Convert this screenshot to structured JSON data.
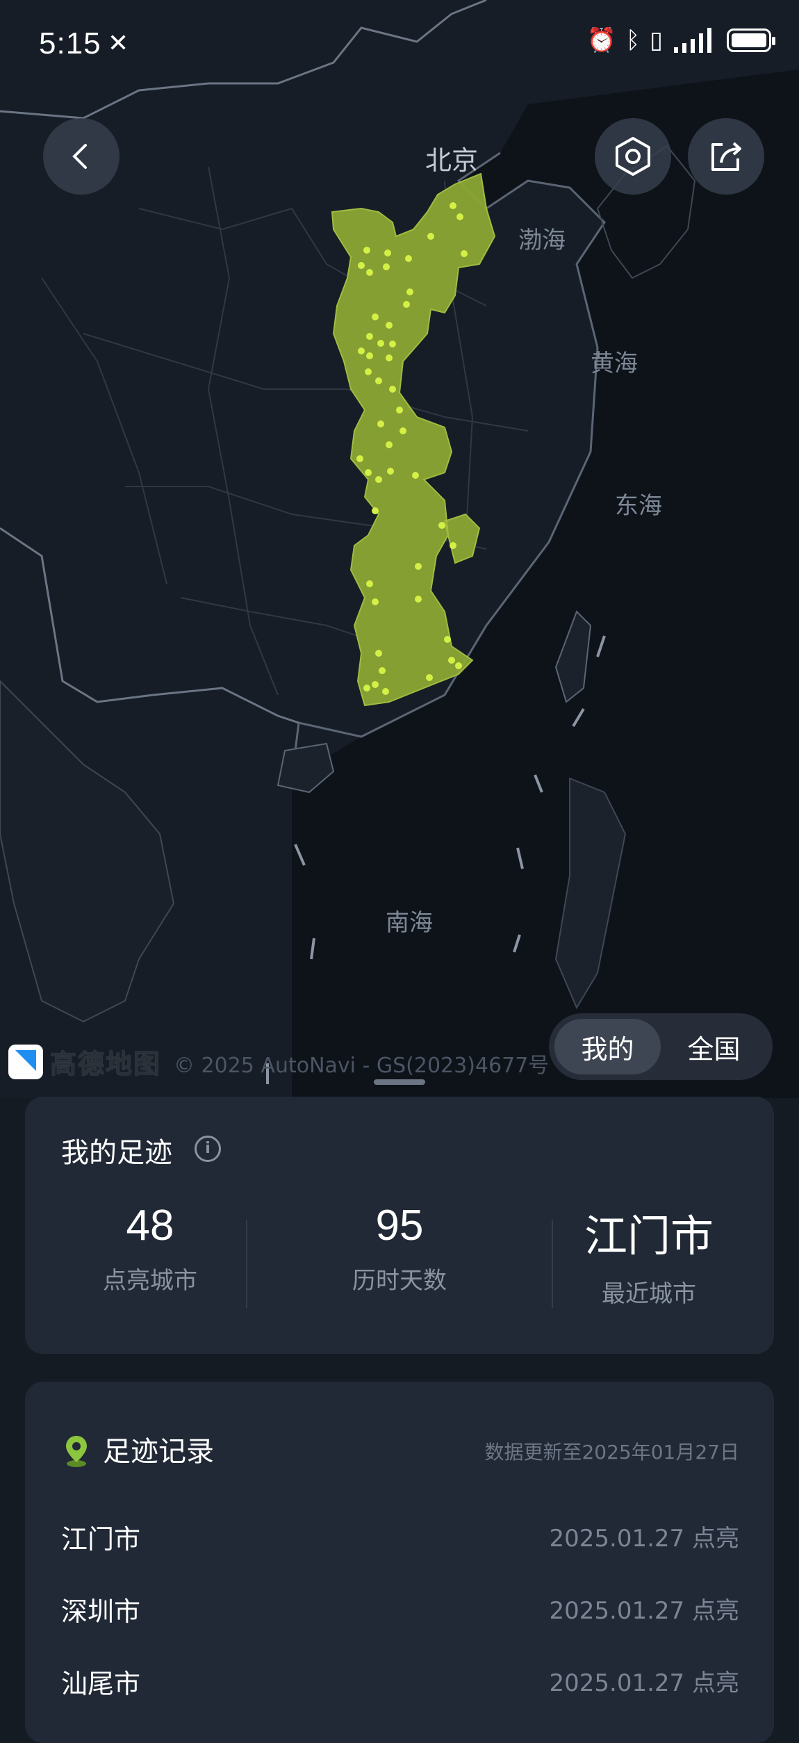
{
  "status_bar": {
    "time": "5:15",
    "notification_icon": "muted-icon",
    "right_icons": [
      "alarm-icon",
      "bluetooth-icon",
      "vibrate-icon",
      "signal-icon",
      "battery-icon"
    ]
  },
  "map": {
    "labels": {
      "beijing": "北京",
      "bohai": "渤海",
      "yellow_sea": "黄海",
      "east_sea": "东海",
      "south_sea": "南海"
    },
    "highlight_color": "#8ba733",
    "city_dot_color": "#d4f046",
    "back_icon": "chevron-left-icon",
    "settings_icon": "hexagon-gear-icon",
    "share_icon": "share-icon"
  },
  "toggle": {
    "mine": "我的",
    "national": "全国",
    "selected": "我的"
  },
  "attribution": {
    "logo_text": "高德地图",
    "copyright": "© 2025 AutoNavi - GS(2023)4677号"
  },
  "footprint_card": {
    "title": "我的足迹",
    "stats": [
      {
        "value": "48",
        "label": "点亮城市"
      },
      {
        "value": "95",
        "label": "历时天数"
      },
      {
        "value": "江门市",
        "label": "最近城市"
      }
    ]
  },
  "records_card": {
    "title": "足迹记录",
    "update_text": "数据更新至2025年01月27日",
    "records": [
      {
        "city": "江门市",
        "date": "2025.01.27 点亮"
      },
      {
        "city": "深圳市",
        "date": "2025.01.27 点亮"
      },
      {
        "city": "汕尾市",
        "date": "2025.01.27 点亮"
      }
    ]
  },
  "colors": {
    "background": "#151b23",
    "card": "#212936",
    "accent_green": "#8cc63f"
  }
}
